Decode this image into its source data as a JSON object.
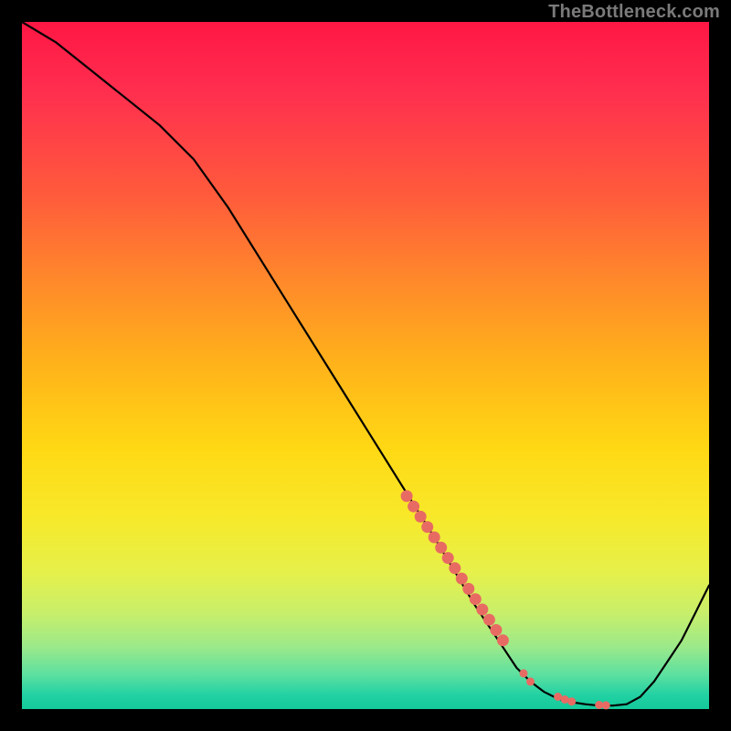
{
  "attribution": "TheBottleneck.com",
  "colors": {
    "background": "#000000",
    "curve": "#000000",
    "marker": "#e86b63",
    "gradient_top": "#ff1744",
    "gradient_bottom": "#14c99a"
  },
  "chart_data": {
    "type": "line",
    "title": "",
    "xlabel": "",
    "ylabel": "",
    "xlim": [
      0,
      100
    ],
    "ylim": [
      0,
      100
    ],
    "note": "Axes have no visible tick labels; x/y values are normalized 0–100. y represents height above the bottom edge (higher = redder / worse).",
    "series": [
      {
        "name": "bottleneck-curve",
        "x": [
          0,
          5,
          10,
          15,
          20,
          25,
          30,
          35,
          40,
          45,
          50,
          55,
          60,
          63,
          66,
          68,
          70,
          72,
          74,
          76,
          78,
          80,
          82,
          84,
          86,
          88,
          90,
          92,
          94,
          96,
          98,
          100
        ],
        "y": [
          100,
          97,
          93,
          89,
          85,
          80,
          73,
          65,
          57,
          49,
          41,
          33,
          25,
          20,
          15,
          12,
          9,
          6,
          4,
          2.5,
          1.5,
          1,
          0.7,
          0.5,
          0.5,
          0.7,
          1.8,
          4,
          7,
          10,
          14,
          18
        ]
      }
    ],
    "markers": {
      "name": "highlighted-segment",
      "comment": "Dense salmon dots along the descending limb near the valley, plus a few spaced dots in the trough.",
      "points_xy": [
        [
          56,
          31
        ],
        [
          57,
          29.5
        ],
        [
          58,
          28
        ],
        [
          59,
          26.5
        ],
        [
          60,
          25
        ],
        [
          61,
          23.5
        ],
        [
          62,
          22
        ],
        [
          63,
          20.5
        ],
        [
          64,
          19
        ],
        [
          65,
          17.5
        ],
        [
          66,
          16
        ],
        [
          67,
          14.5
        ],
        [
          68,
          13
        ],
        [
          69,
          11.5
        ],
        [
          70,
          10
        ],
        [
          73,
          5.2
        ],
        [
          74,
          4.0
        ],
        [
          78,
          1.8
        ],
        [
          79,
          1.4
        ],
        [
          80,
          1.1
        ],
        [
          84,
          0.6
        ],
        [
          85,
          0.55
        ]
      ],
      "radius_large_indices": [
        0,
        1,
        2,
        3,
        4,
        5,
        6,
        7,
        8,
        9,
        10,
        11,
        12,
        13,
        14
      ],
      "radius_large": 6.5,
      "radius_small": 4.5
    }
  }
}
